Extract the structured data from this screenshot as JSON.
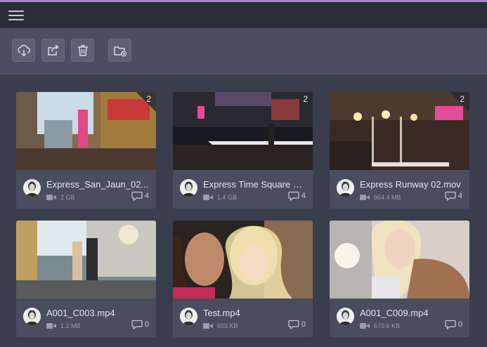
{
  "colors": {
    "accent": "#b07fe0",
    "topbar": "#2b2d39",
    "toolbar": "#4a4e62",
    "page": "#3a3d4c",
    "card": "#4a4d5e"
  },
  "topbar": {
    "menu_icon": "hamburger-menu-icon"
  },
  "toolbar": {
    "buttons": [
      {
        "icon": "cloud-download-icon"
      },
      {
        "icon": "share-export-icon"
      },
      {
        "icon": "trash-icon"
      },
      {
        "icon": "folder-add-icon"
      }
    ]
  },
  "cards": [
    {
      "title": "Express_San_Jaun_02...",
      "size": "2 GB",
      "comments": "4",
      "count": "2"
    },
    {
      "title": "Express Time Square G...",
      "size": "1.4 GB",
      "comments": "4",
      "count": "2"
    },
    {
      "title": "Express Runway 02.mov",
      "size": "964.4 MB",
      "comments": "4",
      "count": "2"
    },
    {
      "title": "A001_C003.mp4",
      "size": "1.2 MB",
      "comments": "0",
      "count": ""
    },
    {
      "title": "Test.mp4",
      "size": "603 KB",
      "comments": "0",
      "count": ""
    },
    {
      "title": "A001_C009.mp4",
      "size": "670.6 KB",
      "comments": "0",
      "count": ""
    }
  ]
}
